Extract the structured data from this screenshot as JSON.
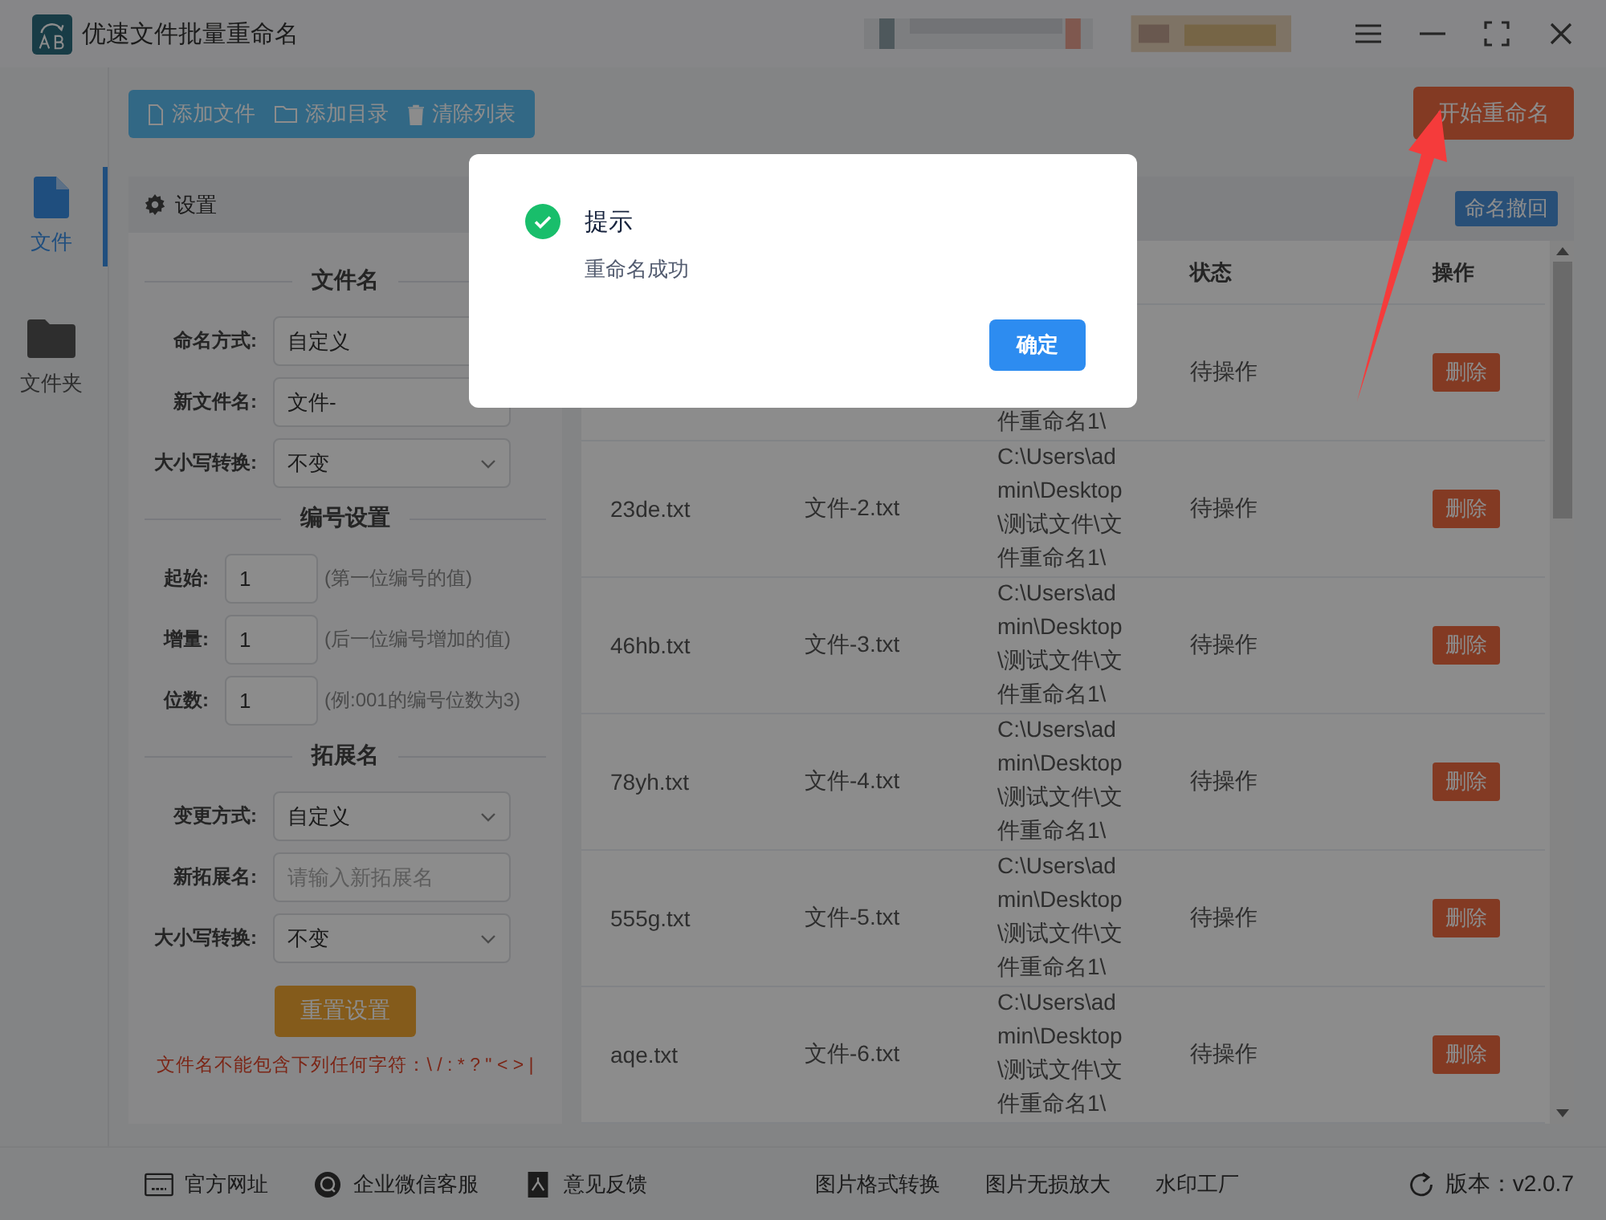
{
  "window": {
    "title": "优速文件批量重命名"
  },
  "toolbar": [
    {
      "label": "添加文件",
      "kind": "file"
    },
    {
      "label": "添加目录",
      "kind": "folder"
    },
    {
      "label": "清除列表",
      "kind": "trash"
    }
  ],
  "start_button": "开始重命名",
  "nav": [
    {
      "label": "文件",
      "kind": "file",
      "selected": true
    },
    {
      "label": "文件夹",
      "kind": "folder",
      "selected": false
    }
  ],
  "settings": {
    "title": "设置",
    "sections": [
      {
        "title": "文件名",
        "fields": [
          {
            "label": "命名方式:",
            "kind": "select",
            "value": "自定义"
          },
          {
            "label": "新文件名:",
            "kind": "input",
            "value": "文件-"
          },
          {
            "label": "大小写转换:",
            "kind": "select",
            "value": "不变",
            "caret": true
          }
        ]
      },
      {
        "title": "编号设置",
        "fields": [
          {
            "label": "起始:",
            "kind": "number",
            "value": "1",
            "hint": "(第一位编号的值)"
          },
          {
            "label": "增量:",
            "kind": "number",
            "value": "1",
            "hint": "(后一位编号增加的值)"
          },
          {
            "label": "位数:",
            "kind": "number",
            "value": "1",
            "hint": "(例:001的编号位数为3)"
          }
        ]
      },
      {
        "title": "拓展名",
        "fields": [
          {
            "label": "变更方式:",
            "kind": "select",
            "value": "自定义",
            "caret": true
          },
          {
            "label": "新拓展名:",
            "kind": "input",
            "placeholder": "请输入新拓展名"
          },
          {
            "label": "大小写转换:",
            "kind": "select",
            "value": "不变",
            "caret": true
          }
        ]
      }
    ],
    "reset_button": "重置设置",
    "warning": "文件名不能包含下列任何字符：\\ / : * ? \" < > |"
  },
  "table": {
    "undo_button": "命名撤回",
    "columns": [
      {
        "label": "状态"
      },
      {
        "label": "操作"
      }
    ],
    "rows": [
      {
        "path": "件重命名1\\",
        "status": "待操作",
        "action": "删除"
      },
      {
        "name": "23de.txt",
        "new_name": "文件-2.txt",
        "path": "C:\\Users\\admin\\Desktop\\测试文件\\文件重命名1\\",
        "status": "待操作",
        "action": "删除"
      },
      {
        "name": "46hb.txt",
        "new_name": "文件-3.txt",
        "path": "C:\\Users\\admin\\Desktop\\测试文件\\文件重命名1\\",
        "status": "待操作",
        "action": "删除"
      },
      {
        "name": "78yh.txt",
        "new_name": "文件-4.txt",
        "path": "C:\\Users\\admin\\Desktop\\测试文件\\文件重命名1\\",
        "status": "待操作",
        "action": "删除"
      },
      {
        "name": "555g.txt",
        "new_name": "文件-5.txt",
        "path": "C:\\Users\\admin\\Desktop\\测试文件\\文件重命名1\\",
        "status": "待操作",
        "action": "删除"
      },
      {
        "name": "aqe.txt",
        "new_name": "文件-6.txt",
        "path": "C:\\Users\\admin\\Desktop\\测试文件\\文件重命名1\\",
        "status": "待操作",
        "action": "删除"
      }
    ]
  },
  "footer": {
    "links": [
      {
        "label": "官方网址",
        "kind": "web"
      },
      {
        "label": "企业微信客服",
        "kind": "chat"
      },
      {
        "label": "意见反馈",
        "kind": "feedback"
      }
    ],
    "tools": [
      "图片格式转换",
      "图片无损放大",
      "水印工厂"
    ],
    "version": "版本：v2.0.7"
  },
  "dialog": {
    "title": "提示",
    "message": "重命名成功",
    "button": "确定"
  }
}
